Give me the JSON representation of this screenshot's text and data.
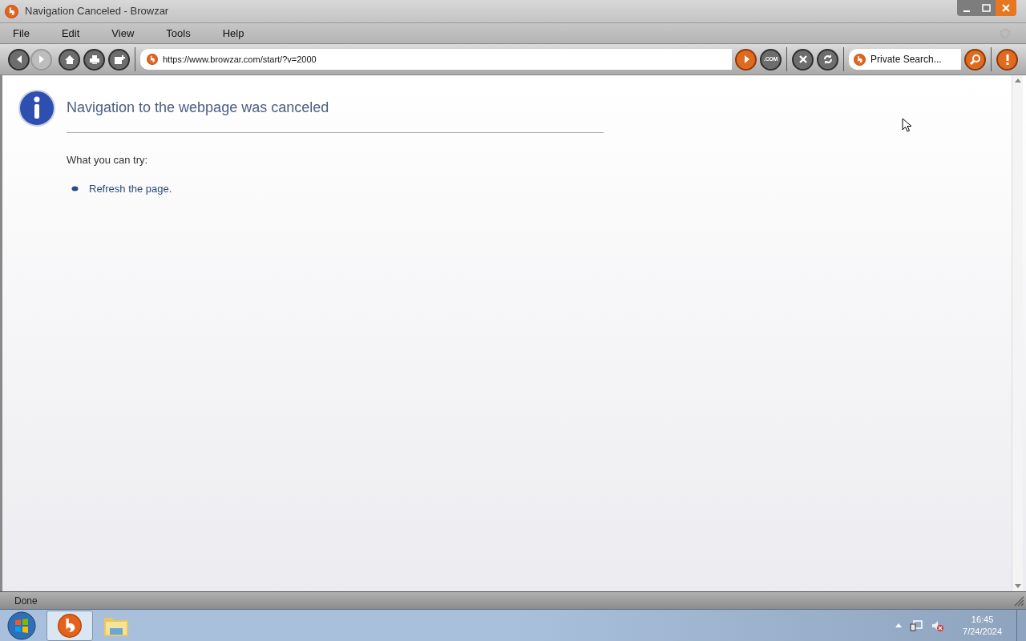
{
  "window": {
    "title": "Navigation Canceled - Browzar"
  },
  "menu": [
    "File",
    "Edit",
    "View",
    "Tools",
    "Help"
  ],
  "nav_buttons": [
    {
      "kind": "back",
      "disabled": false
    },
    {
      "kind": "forward",
      "disabled": true
    }
  ],
  "address_bar": {
    "value": "https://www.browzar.com/start/?v=2000"
  },
  "dot_com_button": ".COM",
  "search": {
    "placeholder": "Private Search..."
  },
  "page": {
    "heading": "Navigation to the webpage was canceled",
    "subheading": "What you can try:",
    "suggestions": [
      "Refresh the page."
    ]
  },
  "status_bar": "Done",
  "taskbar": {
    "time": "16:45",
    "date": "7/24/2024"
  }
}
